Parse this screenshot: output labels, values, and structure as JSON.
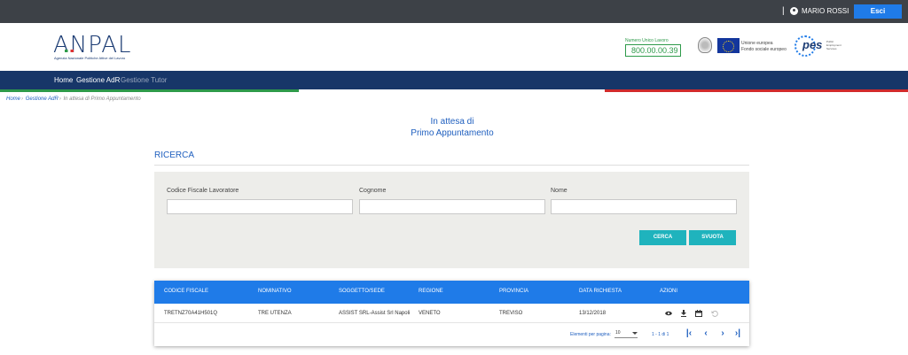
{
  "topbar": {
    "separator": "|",
    "user_name": "MARIO ROSSI",
    "exit_label": "Esci",
    "icon": "user-circle-icon"
  },
  "header": {
    "logo_text": "ANPAL",
    "logo_subtitle": "Agenzia Nazionale Politiche Attive del Lavoro",
    "numero_label": "Numero Unico Lavoro",
    "numero_value": "800.00.00.39",
    "eu_line1": "Unione europea",
    "eu_line2": "Fondo sociale europeo",
    "pes_word": "pes",
    "pes_side": "Public Employment Services"
  },
  "nav": {
    "items": [
      "Home",
      "Gestione AdR",
      "Gestione Tutor"
    ]
  },
  "breadcrumb": {
    "items": [
      "Home",
      "Gestione AdR",
      "In attesa di Primo Appuntamento"
    ],
    "separator": "›"
  },
  "page": {
    "title_line1": "In attesa di",
    "title_line2": "Primo Appuntamento"
  },
  "search": {
    "section_label": "RICERCA",
    "fields": [
      {
        "label": "Codice Fiscale Lavoratore",
        "value": "",
        "placeholder": ""
      },
      {
        "label": "Cognome",
        "value": "",
        "placeholder": ""
      },
      {
        "label": "Nome",
        "value": "",
        "placeholder": ""
      }
    ],
    "search_button": "CERCA",
    "clear_button": "SVUOTA"
  },
  "table": {
    "columns": [
      "CODICE FISCALE",
      "NOMINATIVO",
      "SOGGETTO/SEDE",
      "REGIONE",
      "PROVINCIA",
      "DATA RICHIESTA",
      "AZIONI"
    ],
    "rows": [
      {
        "codice_fiscale": "TRETNZ70A41H501Q",
        "nominativo": "TRE UTENZA",
        "soggetto_sede": "ASSIST SRL-Assist Srl Napoli",
        "regione": "VENETO",
        "provincia": "TREVISO",
        "data_richiesta": "13/12/2018",
        "actions": [
          "eye-icon",
          "download-icon",
          "calendar-icon",
          "undo-icon"
        ]
      }
    ]
  },
  "pagination": {
    "items_per_page_label": "Elementi per pagina:",
    "items_per_page": "10",
    "range": "1 - 1 di 1",
    "first": "|‹",
    "prev": "‹",
    "next": "›",
    "last": "›|"
  },
  "colors": {
    "topbar": "#3d4147",
    "navbar": "#173668",
    "accent_blue": "#1f7be8",
    "teal": "#1fb3bd",
    "green": "#2e9a4a",
    "red": "#d12b2b"
  }
}
